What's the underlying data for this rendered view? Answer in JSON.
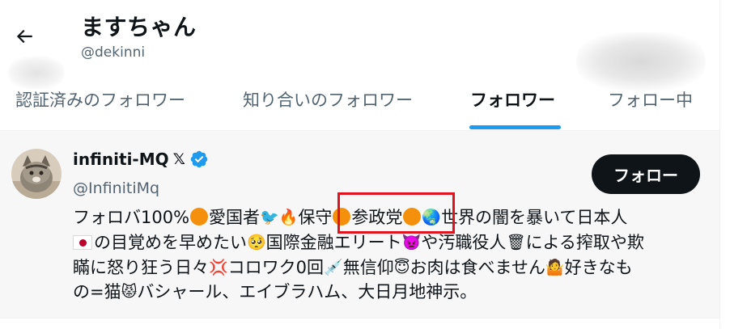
{
  "header": {
    "title": "ますちゃん",
    "handle": "@dekinni"
  },
  "tabs": [
    {
      "label": "認証済みのフォロワー",
      "active": false
    },
    {
      "label": "知り合いのフォロワー",
      "active": false
    },
    {
      "label": "フォロワー",
      "active": true
    },
    {
      "label": "フォロー中",
      "active": false
    }
  ],
  "colors": {
    "accent": "#1d9bf0",
    "highlight": "#e0131f",
    "button_bg": "#0f1419"
  },
  "user": {
    "name": "infiniti-MQ",
    "x_badge": "𝕏",
    "handle": "@InfinitiMq",
    "verified": true,
    "follow_label": "フォロー",
    "bio_lines": [
      {
        "t1": "フォロバ100%",
        "t2": "愛国者",
        "t3": "保守",
        "t4": "参政党",
        "t5": "世界の闇を暴いて日本人"
      },
      {
        "t1": "の目覚めを早めたい",
        "t2": "国際金融エリート",
        "t3": "や汚職役人",
        "t4": "による搾取や欺"
      },
      {
        "t1": "瞞に怒り狂う日々",
        "t2": "コロワク0回",
        "t3": "無信仰",
        "t4": "お肉は食べません",
        "t5": "好きなも"
      },
      {
        "t1": "の=猫",
        "t2": "バシャール、エイブラハム、大日月地神示。"
      }
    ],
    "bio_icons": [
      "orange-circle",
      "bird",
      "fire",
      "orange-circle",
      "orange-circle",
      "globe",
      "japan-flag",
      "pleading-face",
      "imp-face",
      "wastebasket",
      "anger-symbol",
      "syringe",
      "halo-face",
      "person-shrugging",
      "cat-face"
    ]
  }
}
